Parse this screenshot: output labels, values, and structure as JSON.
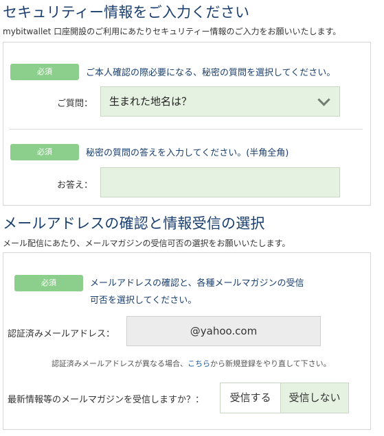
{
  "security": {
    "title": "セキュリティー情報をご入力ください",
    "description": "mybitwallet 口座開設のご利用にあたりセキュリティー情報のご入力をお願いいたします。",
    "required_badge": "必須",
    "question_prompt": "ご本人確認の際必要になる、秘密の質問を選択してください。",
    "question_label": "ご質問：",
    "question_selected": "生まれた地名は？",
    "answer_prompt": "秘密の質問の答えを入力してください。(半角全角)",
    "answer_label": "お答え：",
    "answer_value": ""
  },
  "mail": {
    "title": "メールアドレスの確認と情報受信の選択",
    "description": "メール配信にあたり、メールマガジンの受信可否の選択をお願いいたします。",
    "required_badge": "必須",
    "prompt_line1": "メールアドレスの確認と、各種メールマガジンの受信",
    "prompt_line2": "可否を選択してください。",
    "email_label": "認証済みメールアドレス：",
    "email_value": "@yahoo.com",
    "note_prefix": "認証済みメールアドレスが異なる場合、",
    "note_link": "こちら",
    "note_suffix": "から新規登録をやり直して下さい。",
    "newsletter_question": "最新情報等のメールマガジンを受信しますか？：",
    "option_receive": "受信する",
    "option_not_receive": "受信しない",
    "selected_option": "受信しない"
  }
}
